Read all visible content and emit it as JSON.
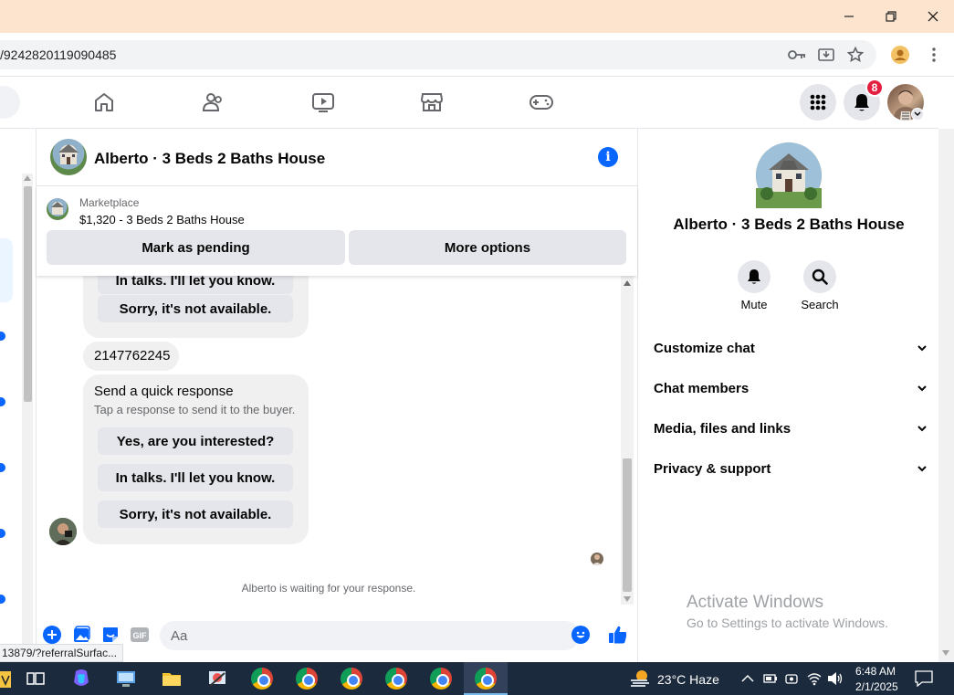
{
  "browser": {
    "url": "/9242820119090485",
    "status_url": "13879/?referralSurfac..."
  },
  "nav": {
    "notification_count": "8"
  },
  "chat": {
    "title": "Alberto · 3 Beds 2 Baths House",
    "marketplace_label": "Marketplace",
    "listing": "$1,320 - 3 Beds 2 Baths House",
    "mark_pending": "Mark as pending",
    "more_options": "More options"
  },
  "messages": {
    "partial_reply_top": "In talks. I'll let you know.",
    "partial_reply_bottom": "Sorry, it's not available.",
    "phone": "2147762245",
    "quick_title": "Send a quick response",
    "quick_sub": "Tap a response to send it to the buyer.",
    "replies": [
      "Yes, are you interested?",
      "In talks. I'll let you know.",
      "Sorry, it's not available."
    ],
    "waiting": "Alberto is waiting for your response."
  },
  "composer": {
    "placeholder": "Aa"
  },
  "panel": {
    "title": "Alberto · 3 Beds 2 Baths House",
    "mute": "Mute",
    "search": "Search",
    "sections": [
      "Customize chat",
      "Chat members",
      "Media, files and links",
      "Privacy & support"
    ]
  },
  "watermark": {
    "line1": "Activate Windows",
    "line2": "Go to Settings to activate Windows."
  },
  "taskbar": {
    "weather": "23°C  Haze",
    "time": "6:48 AM",
    "date": "2/1/2025"
  },
  "colors": {
    "fb_blue": "#0866ff",
    "badge_red": "#e41e3f",
    "titlebar": "#fce4cf",
    "taskbar": "#1c2a3d"
  }
}
